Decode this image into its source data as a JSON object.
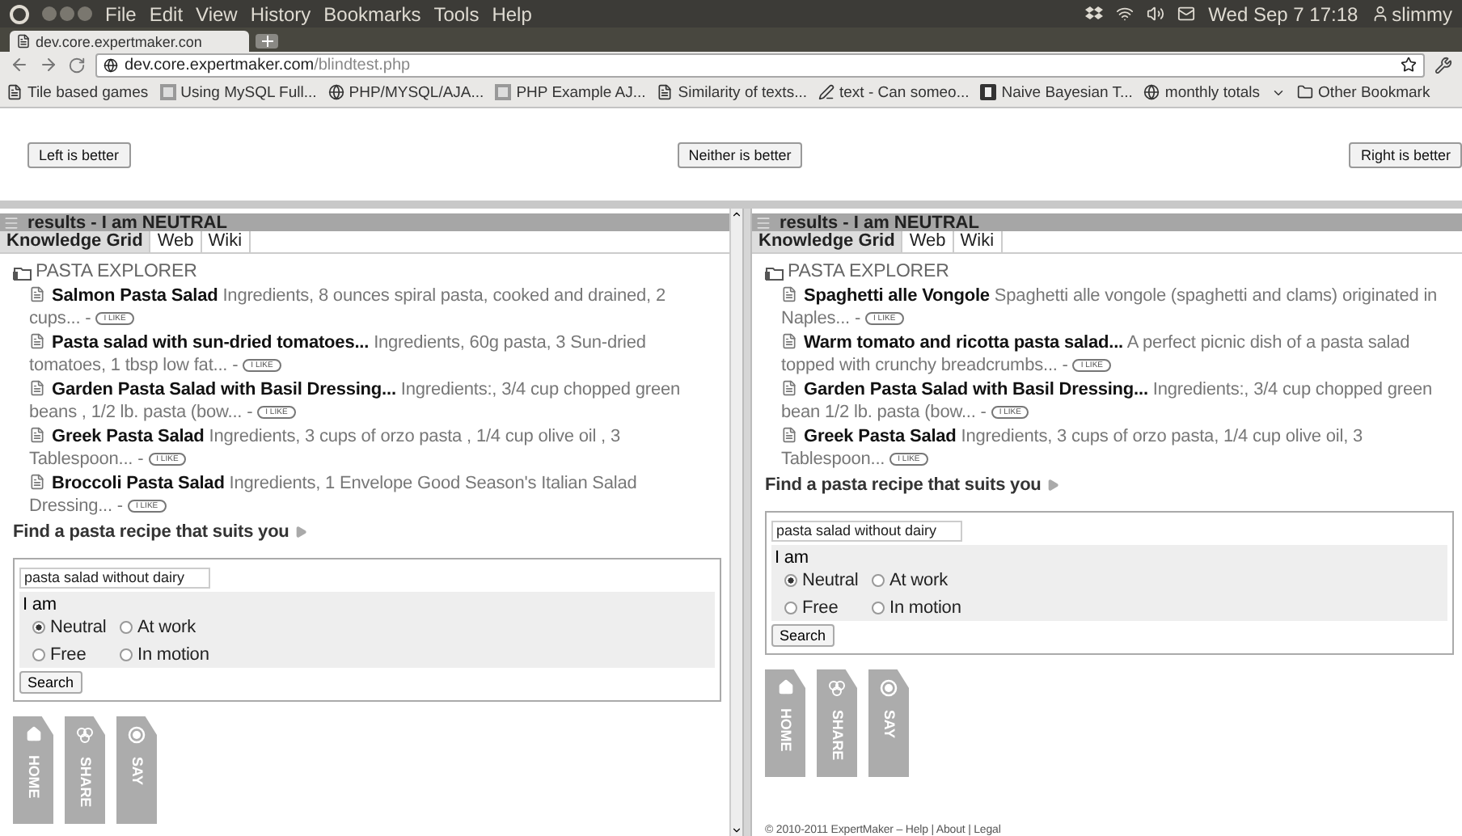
{
  "os_panel": {
    "menus": [
      "File",
      "Edit",
      "View",
      "History",
      "Bookmarks",
      "Tools",
      "Help"
    ],
    "clock": "Wed Sep  7 17:18",
    "user": "slimmy"
  },
  "browser": {
    "tab_title": "dev.core.expertmaker.con",
    "url_host": "dev.core.expertmaker.com",
    "url_path": "/blindtest.php",
    "bookmarks": [
      {
        "label": "Tile based games",
        "kind": "page"
      },
      {
        "label": "Using MySQL Full...",
        "kind": "tile"
      },
      {
        "label": "PHP/MYSQL/AJA...",
        "kind": "g"
      },
      {
        "label": "PHP Example AJ...",
        "kind": "tile"
      },
      {
        "label": "Similarity of texts...",
        "kind": "page"
      },
      {
        "label": "text - Can someo...",
        "kind": "pen"
      },
      {
        "label": "Naive Bayesian T...",
        "kind": "d"
      },
      {
        "label": "monthly totals",
        "kind": "g"
      }
    ],
    "other_bookmarks": "Other Bookmark"
  },
  "compare_buttons": [
    "Left is better",
    "Neither is better",
    "Right is better"
  ],
  "panels": [
    {
      "title": "results - I am NEUTRAL",
      "tabs": [
        {
          "label": "Knowledge Grid",
          "selected": true
        },
        {
          "label": "Web",
          "selected": false
        },
        {
          "label": "Wiki",
          "selected": false
        }
      ],
      "section": "PASTA EXPLORER",
      "results": [
        {
          "title": "Salmon Pasta Salad",
          "snippet": "Ingredients, 8 ounces spiral pasta, cooked and drained, 2 cups... -",
          "like": "I LIKE"
        },
        {
          "title": "Pasta salad with sun-dried tomatoes...",
          "snippet": "Ingredients, 60g pasta, 3 Sun-dried tomatoes, 1 tbsp low fat... -",
          "like": "I LIKE"
        },
        {
          "title": "Garden Pasta Salad with Basil Dressing...",
          "snippet": "Ingredients:, 3/4 cup chopped green beans , 1/2 lb. pasta (bow... -",
          "like": "I LIKE"
        },
        {
          "title": "Greek Pasta Salad",
          "snippet": "Ingredients, 3 cups of orzo pasta , 1/4 cup olive oil , 3 Tablespoon... -",
          "like": "I LIKE"
        },
        {
          "title": "Broccoli Pasta Salad",
          "snippet": "Ingredients, 1 Envelope Good Season's Italian Salad Dressing... -",
          "like": "I LIKE"
        }
      ],
      "find_link": "Find a pasta recipe that suits you",
      "query": "pasta salad without dairy",
      "iam_label": "I am",
      "options": [
        {
          "label": "Neutral",
          "selected": true
        },
        {
          "label": "At work",
          "selected": false
        },
        {
          "label": "Free",
          "selected": false
        },
        {
          "label": "In motion",
          "selected": false
        }
      ],
      "search_button": "Search",
      "tags": [
        {
          "label": "HOME",
          "kind": "home"
        },
        {
          "label": "SHARE",
          "kind": "share"
        },
        {
          "label": "SAY",
          "kind": "say"
        }
      ]
    },
    {
      "title": "results - I am NEUTRAL",
      "tabs": [
        {
          "label": "Knowledge Grid",
          "selected": true
        },
        {
          "label": "Web",
          "selected": false
        },
        {
          "label": "Wiki",
          "selected": false
        }
      ],
      "section": "PASTA EXPLORER",
      "results": [
        {
          "title": "Spaghetti alle Vongole",
          "snippet": "Spaghetti alle vongole (spaghetti and clams) originated in Naples... -",
          "like": "I LIKE"
        },
        {
          "title": "Warm tomato and ricotta pasta salad...",
          "snippet": "A perfect picnic dish of a pasta salad topped with crunchy breadcrumbs... -",
          "like": "I LIKE"
        },
        {
          "title": "Garden Pasta Salad with Basil Dressing...",
          "snippet": "Ingredients:, 3/4 cup chopped green bean 1/2 lb. pasta (bow... -",
          "like": "I LIKE"
        },
        {
          "title": "Greek Pasta Salad",
          "snippet": "Ingredients, 3 cups of orzo pasta, 1/4 cup olive oil, 3 Tablespoon...",
          "like": "I LIKE"
        }
      ],
      "find_link": "Find a pasta recipe that suits you",
      "query": "pasta salad without dairy",
      "iam_label": "I am",
      "options": [
        {
          "label": "Neutral",
          "selected": true
        },
        {
          "label": "At work",
          "selected": false
        },
        {
          "label": "Free",
          "selected": false
        },
        {
          "label": "In motion",
          "selected": false
        }
      ],
      "search_button": "Search",
      "tags": [
        {
          "label": "HOME",
          "kind": "home"
        },
        {
          "label": "SHARE",
          "kind": "share"
        },
        {
          "label": "SAY",
          "kind": "say"
        }
      ],
      "footer": {
        "copyright": "© 2010-2011 ExpertMaker –",
        "separator": "|",
        "links": [
          "Help",
          "About",
          "Legal"
        ]
      }
    }
  ]
}
